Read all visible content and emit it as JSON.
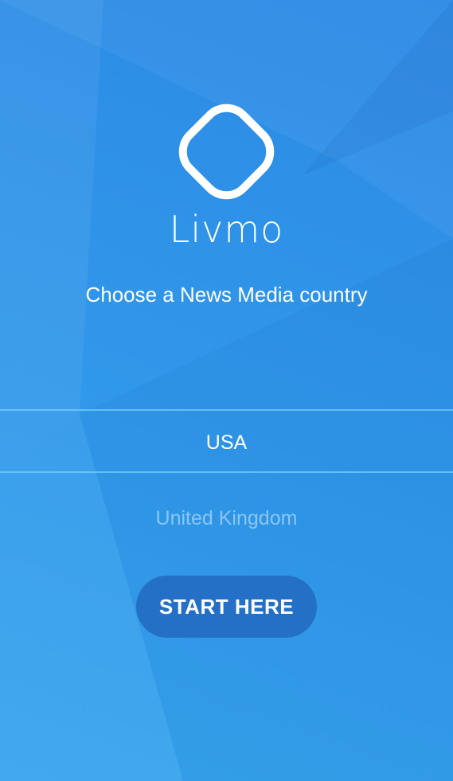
{
  "app": {
    "brand_name": "Livmo",
    "logo_icon": "rounded-diamond-logo-icon"
  },
  "prompt": {
    "text": "Choose a News Media country"
  },
  "country_picker": {
    "options": [
      "USA",
      "United Kingdom"
    ],
    "selected": "USA"
  },
  "start_button": {
    "label": "START HERE"
  },
  "colors": {
    "background": "#2f93e8",
    "button": "#2370c6",
    "text": "#ffffff"
  }
}
